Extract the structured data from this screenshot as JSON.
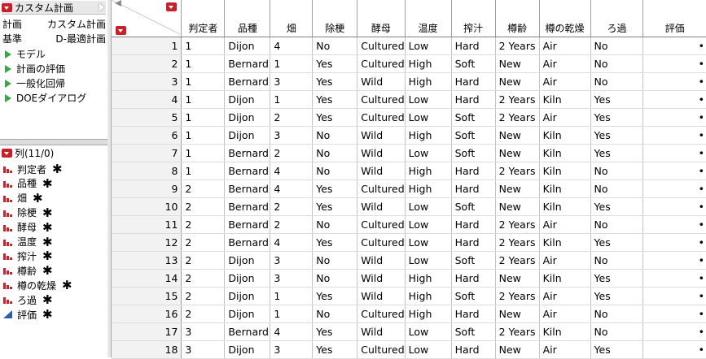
{
  "table_panel": {
    "title": "カスタム計画",
    "props": [
      {
        "key": "計画",
        "value": "カスタム計画"
      },
      {
        "key": "基準",
        "value": "D-最適計画"
      }
    ],
    "scripts": [
      {
        "label": "モデル"
      },
      {
        "label": "計画の評価"
      },
      {
        "label": "一般化回帰"
      },
      {
        "label": "DOEダイアログ"
      }
    ]
  },
  "columns_panel": {
    "header": "列(11/0)",
    "items": [
      {
        "label": "判定者",
        "icon": "ordinal-bar-icon"
      },
      {
        "label": "品種",
        "icon": "nominal-bar-icon"
      },
      {
        "label": "畑",
        "icon": "nominal-bar-icon"
      },
      {
        "label": "除梗",
        "icon": "nominal-bar-icon"
      },
      {
        "label": "酵母",
        "icon": "nominal-bar-icon"
      },
      {
        "label": "温度",
        "icon": "nominal-bar-icon"
      },
      {
        "label": "搾汁",
        "icon": "nominal-bar-icon"
      },
      {
        "label": "樽齢",
        "icon": "nominal-bar-icon"
      },
      {
        "label": "樽の乾燥",
        "icon": "nominal-bar-icon"
      },
      {
        "label": "ろ過",
        "icon": "nominal-bar-icon"
      },
      {
        "label": "評価",
        "icon": "continuous-triangle-icon"
      }
    ],
    "star": "✱"
  },
  "grid": {
    "headers": [
      "判定者",
      "品種",
      "畑",
      "除梗",
      "酵母",
      "温度",
      "搾汁",
      "樽齢",
      "樽の乾燥",
      "ろ過",
      "評価"
    ],
    "rows": [
      {
        "n": "1",
        "cells": [
          "1",
          "Dijon",
          "4",
          "No",
          "Cultured",
          "Low",
          "Hard",
          "2 Years",
          "Air",
          "No",
          "•"
        ]
      },
      {
        "n": "2",
        "cells": [
          "1",
          "Bernard",
          "1",
          "Yes",
          "Cultured",
          "High",
          "Soft",
          "New",
          "Air",
          "No",
          "•"
        ]
      },
      {
        "n": "3",
        "cells": [
          "1",
          "Bernard",
          "3",
          "Yes",
          "Wild",
          "High",
          "Hard",
          "New",
          "Air",
          "No",
          "•"
        ]
      },
      {
        "n": "4",
        "cells": [
          "1",
          "Dijon",
          "1",
          "Yes",
          "Cultured",
          "Low",
          "Hard",
          "2 Years",
          "Kiln",
          "Yes",
          "•"
        ]
      },
      {
        "n": "5",
        "cells": [
          "1",
          "Dijon",
          "2",
          "Yes",
          "Cultured",
          "Low",
          "Soft",
          "2 Years",
          "Air",
          "Yes",
          "•"
        ]
      },
      {
        "n": "6",
        "cells": [
          "1",
          "Dijon",
          "3",
          "No",
          "Wild",
          "High",
          "Soft",
          "New",
          "Kiln",
          "Yes",
          "•"
        ]
      },
      {
        "n": "7",
        "cells": [
          "1",
          "Bernard",
          "2",
          "No",
          "Wild",
          "Low",
          "Soft",
          "New",
          "Kiln",
          "Yes",
          "•"
        ]
      },
      {
        "n": "8",
        "cells": [
          "1",
          "Bernard",
          "4",
          "No",
          "Wild",
          "High",
          "Hard",
          "2 Years",
          "Kiln",
          "No",
          "•"
        ]
      },
      {
        "n": "9",
        "cells": [
          "2",
          "Bernard",
          "4",
          "Yes",
          "Cultured",
          "High",
          "Hard",
          "New",
          "Kiln",
          "No",
          "•"
        ]
      },
      {
        "n": "10",
        "cells": [
          "2",
          "Bernard",
          "2",
          "Yes",
          "Wild",
          "Low",
          "Soft",
          "New",
          "Kiln",
          "Yes",
          "•"
        ]
      },
      {
        "n": "11",
        "cells": [
          "2",
          "Bernard",
          "2",
          "No",
          "Cultured",
          "Low",
          "Hard",
          "2 Years",
          "Air",
          "No",
          "•"
        ]
      },
      {
        "n": "12",
        "cells": [
          "2",
          "Bernard",
          "4",
          "Yes",
          "Cultured",
          "Low",
          "Hard",
          "2 Years",
          "Kiln",
          "Yes",
          "•"
        ]
      },
      {
        "n": "13",
        "cells": [
          "2",
          "Dijon",
          "3",
          "No",
          "Wild",
          "Low",
          "Soft",
          "2 Years",
          "Air",
          "No",
          "•"
        ]
      },
      {
        "n": "14",
        "cells": [
          "2",
          "Dijon",
          "3",
          "No",
          "Wild",
          "High",
          "Hard",
          "New",
          "Kiln",
          "Yes",
          "•"
        ]
      },
      {
        "n": "15",
        "cells": [
          "2",
          "Dijon",
          "1",
          "Yes",
          "Wild",
          "High",
          "Soft",
          "2 Years",
          "Air",
          "Yes",
          "•"
        ]
      },
      {
        "n": "16",
        "cells": [
          "2",
          "Dijon",
          "1",
          "No",
          "Cultured",
          "High",
          "Hard",
          "New",
          "Air",
          "No",
          "•"
        ]
      },
      {
        "n": "17",
        "cells": [
          "3",
          "Bernard",
          "4",
          "Yes",
          "Wild",
          "Low",
          "Soft",
          "2 Years",
          "Kiln",
          "No",
          "•"
        ]
      },
      {
        "n": "18",
        "cells": [
          "3",
          "Dijon",
          "3",
          "Yes",
          "Cultured",
          "Low",
          "Hard",
          "New",
          "Air",
          "Yes",
          "•"
        ]
      }
    ]
  },
  "colors": {
    "menu_red": "#c8202a",
    "script_green": "#3fa34d",
    "column_icon_red": "#c0282d",
    "continuous_blue": "#2a5db0"
  }
}
